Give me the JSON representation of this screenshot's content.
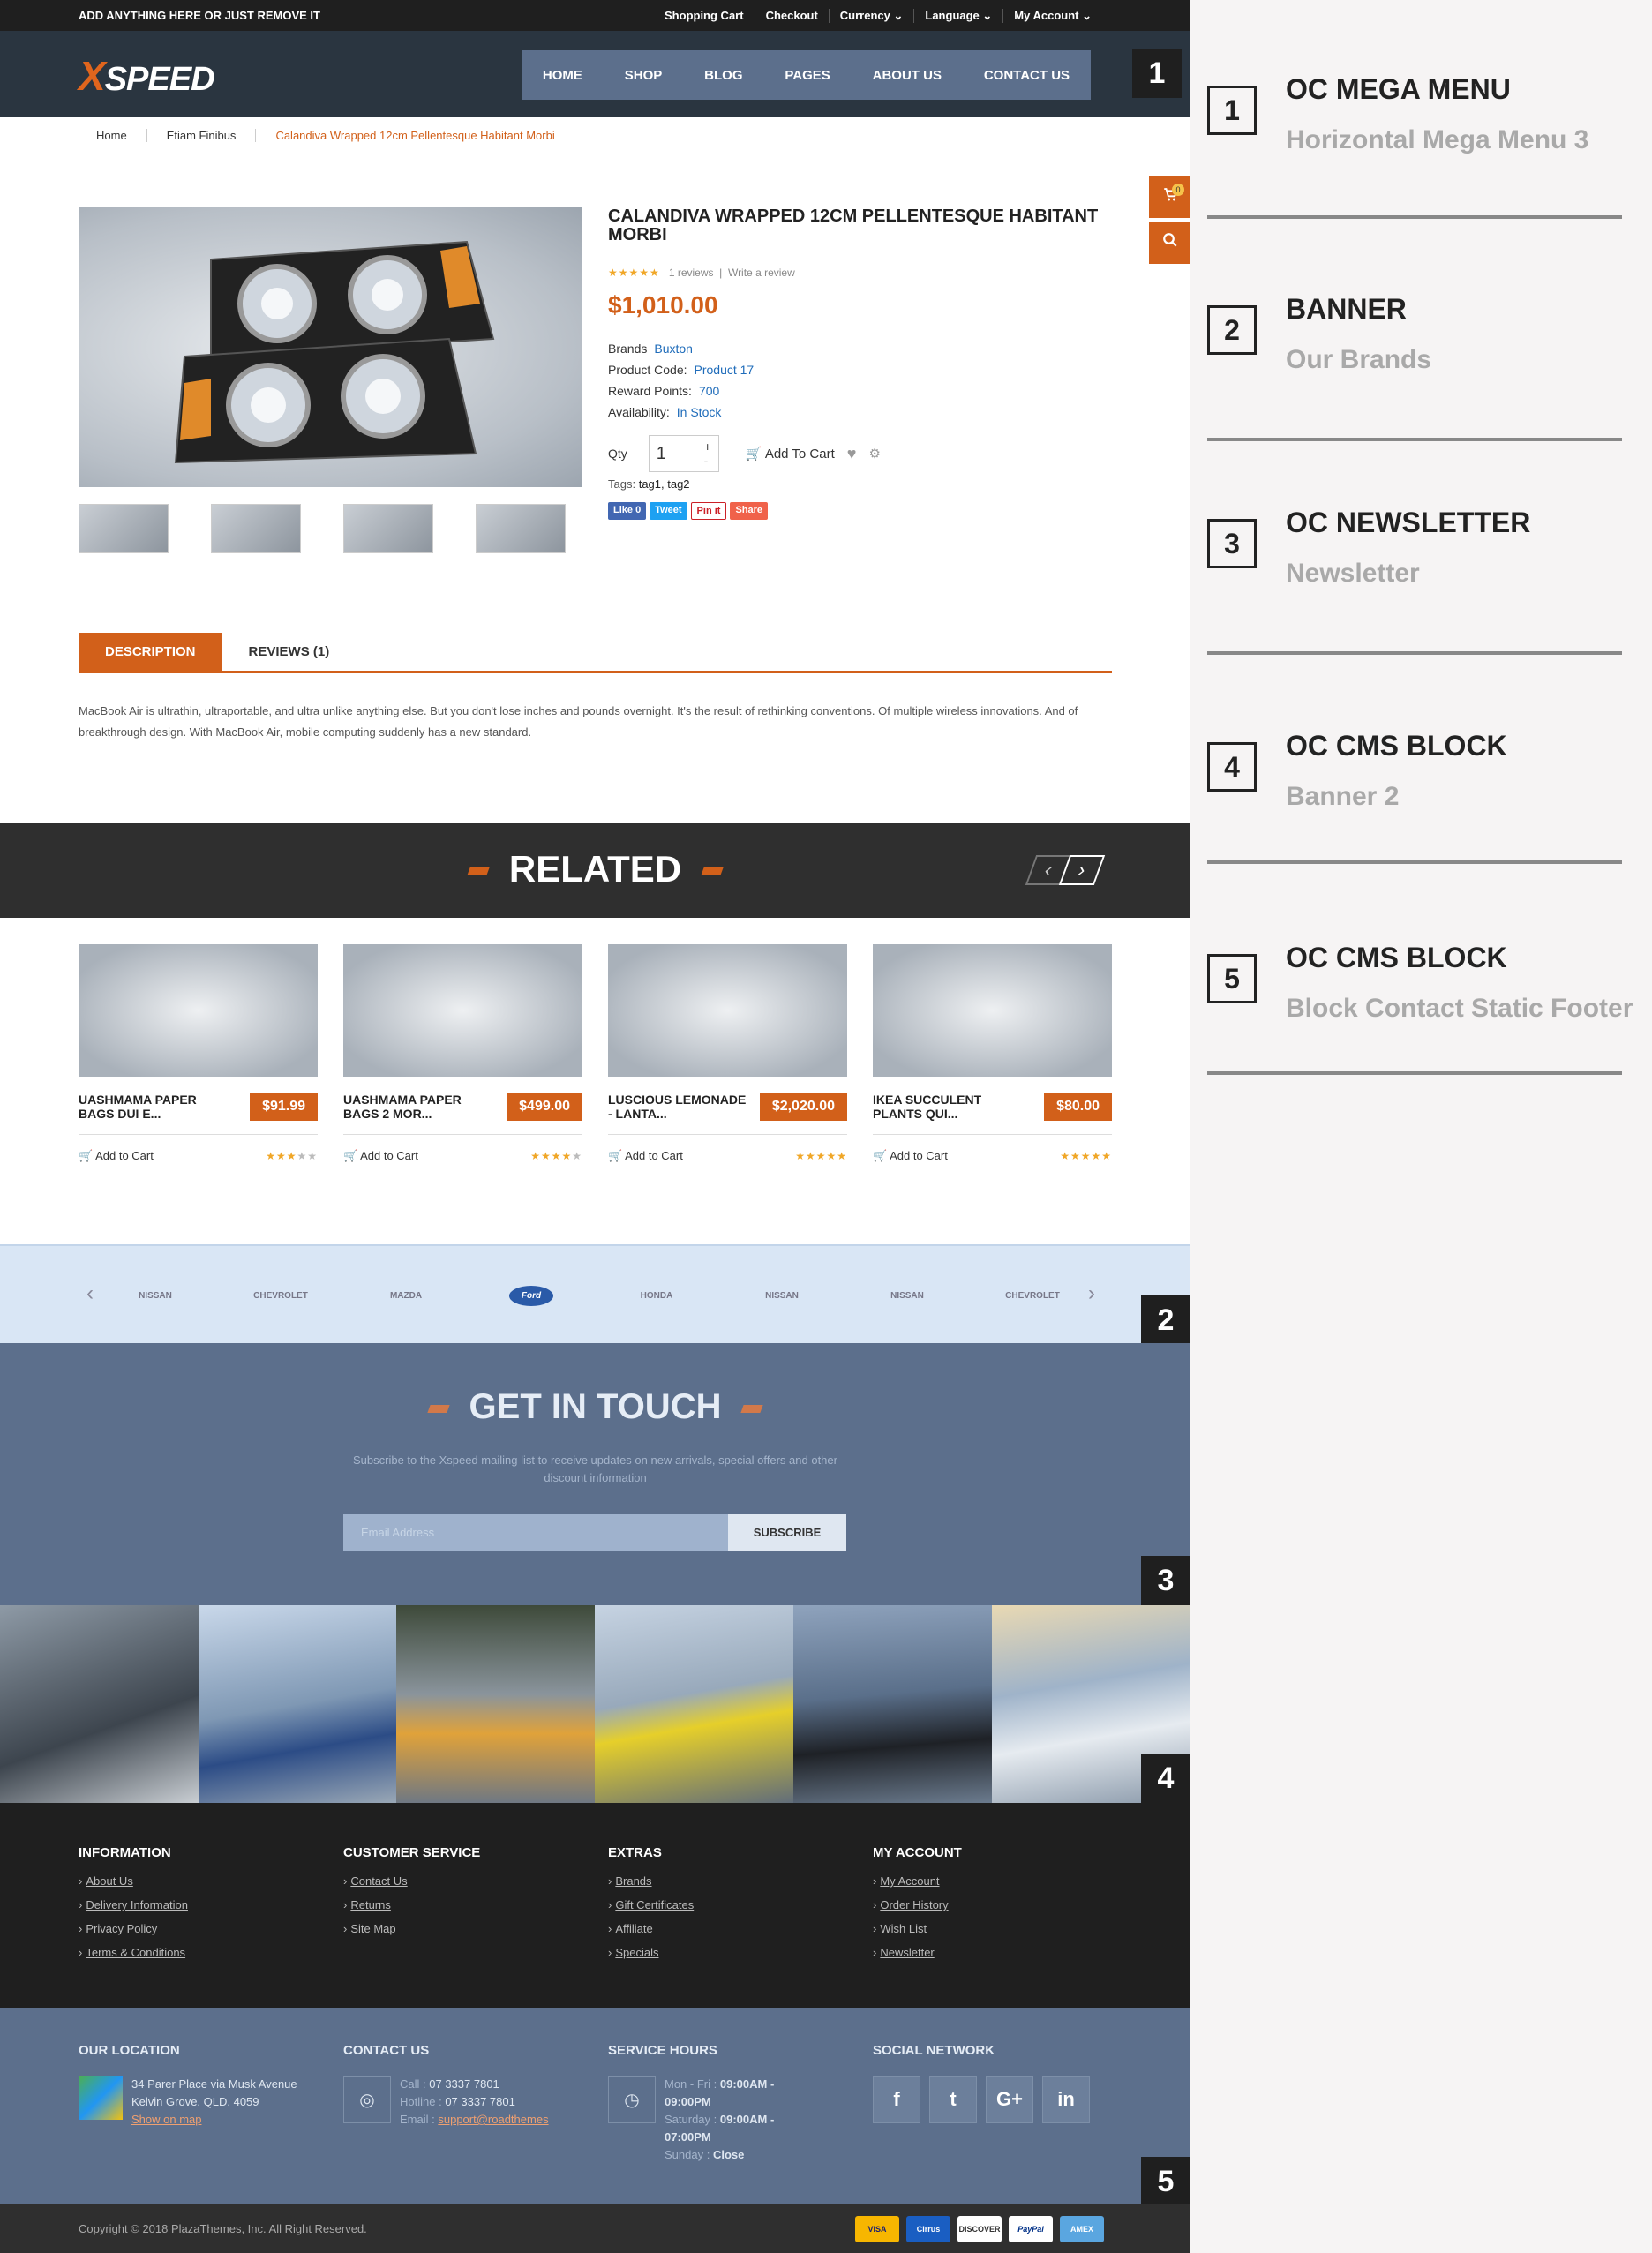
{
  "topbar": {
    "promo": "ADD ANYTHING HERE OR JUST REMOVE IT",
    "links": [
      "Shopping Cart",
      "Checkout",
      "Currency ⌄",
      "Language ⌄",
      "My Account ⌄"
    ]
  },
  "header": {
    "logo_x": "X",
    "logo_rest": "SPEED",
    "nav": [
      "HOME",
      "SHOP",
      "BLOG",
      "PAGES",
      "ABOUT US",
      "CONTACT US"
    ]
  },
  "breadcrumb": [
    "Home",
    "Etiam Finibus",
    "Calandiva Wrapped 12cm Pellentesque Habitant Morbi"
  ],
  "floating": {
    "cart_count": "0"
  },
  "product": {
    "name": "CALANDIVA WRAPPED 12CM PELLENTESQUE HABITANT MORBI",
    "rating_stars": "★★★★★",
    "reviews": "1 reviews",
    "write_review": "Write a review",
    "price": "$1,010.00",
    "brand_label": "Brands",
    "brand": "Buxton",
    "code_label": "Product Code:",
    "code": "Product 17",
    "points_label": "Reward Points:",
    "points": "700",
    "avail_label": "Availability:",
    "avail": "In Stock",
    "qty_label": "Qty",
    "qty": "1",
    "add_to_cart": "Add To Cart",
    "tags_label": "Tags:",
    "tags": "tag1, tag2",
    "share": [
      "Like 0",
      "Tweet",
      "Pin it",
      "Share"
    ]
  },
  "tabs": [
    "DESCRIPTION",
    "REVIEWS (1)"
  ],
  "description": "MacBook Air is ultrathin, ultraportable, and ultra unlike anything else. But you don't lose inches and pounds overnight. It's the result of rethinking conventions. Of multiple wireless innovations. And of breakthrough design. With MacBook Air, mobile computing suddenly has a new standard.",
  "related": {
    "title": "RELATED",
    "items": [
      {
        "name": "UASHMAMA PAPER BAGS DUI E...",
        "price": "$91.99",
        "add": "Add to Cart",
        "rating": 3
      },
      {
        "name": "UASHMAMA PAPER BAGS 2 MOR...",
        "price": "$499.00",
        "add": "Add to Cart",
        "rating": 4
      },
      {
        "name": "LUSCIOUS LEMONADE - LANTA...",
        "price": "$2,020.00",
        "add": "Add to Cart",
        "rating": 5
      },
      {
        "name": "IKEA SUCCULENT PLANTS QUI...",
        "price": "$80.00",
        "add": "Add to Cart",
        "rating": 5
      }
    ]
  },
  "brands": [
    "NISSAN",
    "CHEVROLET",
    "MAZDA",
    "Ford",
    "HONDA",
    "NISSAN",
    "NISSAN",
    "CHEVROLET"
  ],
  "newsletter": {
    "title": "GET IN TOUCH",
    "subtitle": "Subscribe to the Xspeed mailing list to receive updates on new arrivals, special offers and other discount information",
    "placeholder": "Email Address",
    "button": "SUBSCRIBE"
  },
  "footer": {
    "cols": [
      {
        "title": "INFORMATION",
        "links": [
          "About Us",
          "Delivery Information",
          "Privacy Policy",
          "Terms & Conditions"
        ]
      },
      {
        "title": "CUSTOMER SERVICE",
        "links": [
          "Contact Us",
          "Returns",
          "Site Map"
        ]
      },
      {
        "title": "EXTRAS",
        "links": [
          "Brands",
          "Gift Certificates",
          "Affiliate",
          "Specials"
        ]
      },
      {
        "title": "MY ACCOUNT",
        "links": [
          "My Account",
          "Order History",
          "Wish List",
          "Newsletter"
        ]
      }
    ]
  },
  "footer2": {
    "location_title": "OUR LOCATION",
    "address1": "34 Parer Place via Musk Avenue",
    "address2": "Kelvin Grove, QLD, 4059",
    "map_link": "Show on map",
    "contact_title": "CONTACT US",
    "call_label": "Call :",
    "call": "07 3337 7801",
    "hotline_label": "Hotline :",
    "hotline": "07 3337 7801",
    "email_label": "Email :",
    "email": "support@roadthemes",
    "hours_title": "SERVICE HOURS",
    "hours1_label": "Mon - Fri :",
    "hours1": "09:00AM - 09:00PM",
    "hours2_label": "Saturday :",
    "hours2": "09:00AM - 07:00PM",
    "hours3_label": "Sunday :",
    "hours3": "Close",
    "social_title": "SOCIAL NETWORK",
    "social": [
      "f",
      "t",
      "G+",
      "in"
    ]
  },
  "copyright": "Copyright © 2018 PlazaThemes, Inc. All Right Reserved.",
  "payments": [
    "VISA",
    "Cirrus",
    "DISCOVER",
    "PayPal",
    "AMEX"
  ],
  "sidebar": [
    {
      "n": "1",
      "title": "OC MEGA MENU",
      "sub": "Horizontal Mega Menu 3"
    },
    {
      "n": "2",
      "title": "BANNER",
      "sub": "Our Brands"
    },
    {
      "n": "3",
      "title": "OC NEWSLETTER",
      "sub": "Newsletter"
    },
    {
      "n": "4",
      "title": "OC CMS BLOCK",
      "sub": "Banner 2"
    },
    {
      "n": "5",
      "title": "OC CMS BLOCK",
      "sub": "Block Contact Static Footer"
    }
  ],
  "colors": {
    "accent": "#d2601a",
    "header": "#2a3540",
    "steel": "#5c6f8c"
  }
}
